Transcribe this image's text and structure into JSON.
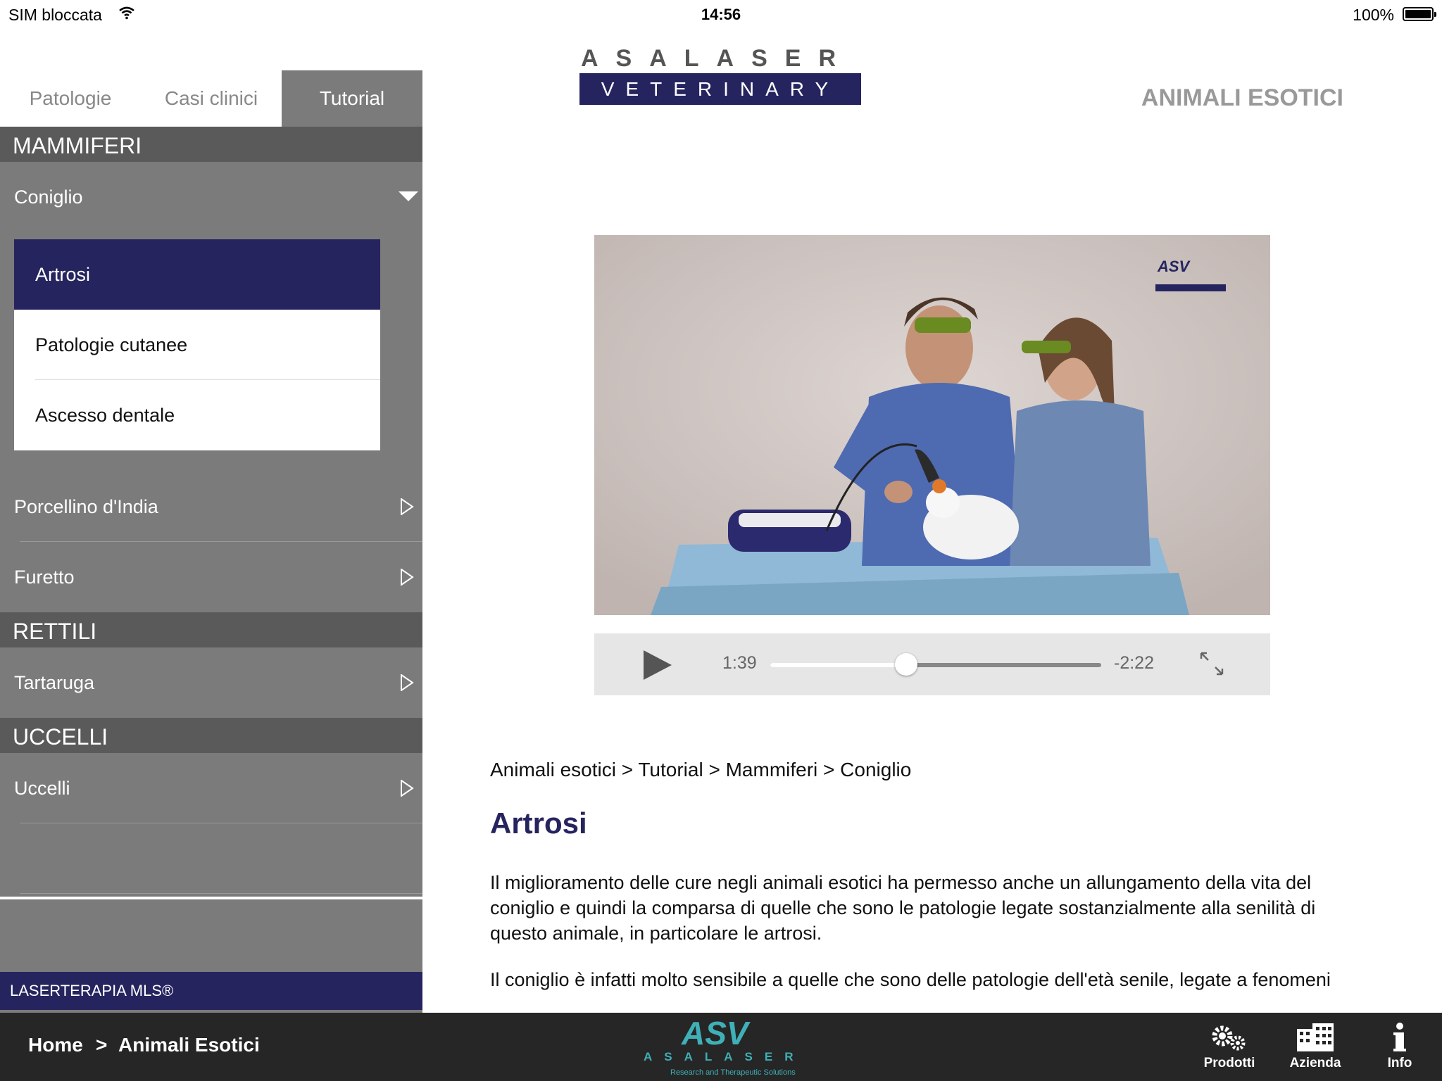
{
  "status_bar": {
    "carrier": "SIM bloccata",
    "time": "14:56",
    "battery": "100%"
  },
  "tabs": [
    {
      "label": "Patologie"
    },
    {
      "label": "Casi clinici"
    },
    {
      "label": "Tutorial"
    }
  ],
  "sidebar": {
    "sections": [
      {
        "title": "MAMMIFERI"
      },
      {
        "title": "RETTILI"
      },
      {
        "title": "UCCELLI"
      }
    ],
    "expanded_item": "Coniglio",
    "subitems": [
      {
        "label": "Artrosi"
      },
      {
        "label": "Patologie cutanee"
      },
      {
        "label": "Ascesso dentale"
      }
    ],
    "items": [
      {
        "label": "Porcellino d'India"
      },
      {
        "label": "Furetto"
      },
      {
        "label": "Tartaruga"
      },
      {
        "label": "Uccelli"
      }
    ],
    "footer": "LASERTERAPIA MLS®"
  },
  "header": {
    "logo_top": "ASALASER",
    "logo_bottom": "VETERINARY",
    "category": "ANIMALI ESOTICI"
  },
  "player": {
    "elapsed": "1:39",
    "remaining": "-2:22",
    "progress": 0.41
  },
  "content": {
    "breadcrumb": "Animali esotici > Tutorial > Mammiferi > Coniglio",
    "title": "Artrosi",
    "paragraph1": "Il miglioramento delle cure negli animali esotici ha permesso anche un allungamento della vita del coniglio e quindi la comparsa di quelle che sono le patologie legate sostanzialmente alla senilità di questo animale, in particolare le artrosi.",
    "paragraph2": "Il coniglio è infatti molto sensibile a quelle che sono delle patologie dell'età senile, legate a fenomeni"
  },
  "bottom_bar": {
    "home": "Home",
    "separator": ">",
    "current": "Animali Esotici",
    "logo_text": "ASALASER",
    "logo_tagline": "Research and Therapeutic Solutions",
    "nav": [
      {
        "label": "Prodotti",
        "icon": "gears-icon"
      },
      {
        "label": "Azienda",
        "icon": "building-icon"
      },
      {
        "label": "Info",
        "icon": "info-icon"
      }
    ]
  },
  "colors": {
    "brand_purple": "#26245f",
    "panel_grey": "#7b7b7b",
    "section_grey": "#5a5a5a",
    "teal": "#3fb0b7"
  }
}
